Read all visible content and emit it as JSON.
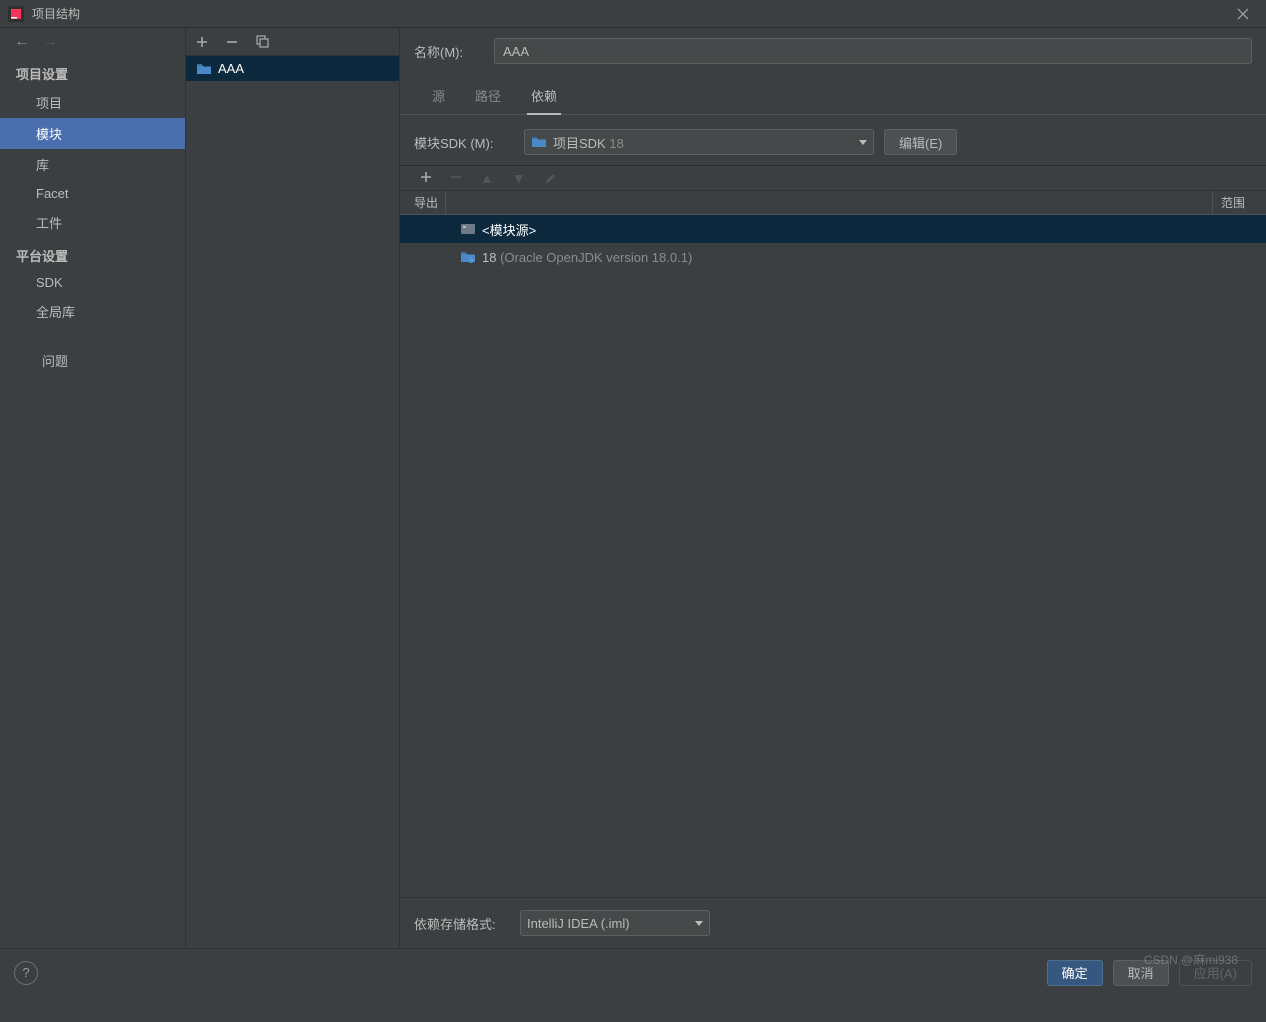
{
  "titlebar": {
    "title": "项目结构"
  },
  "sidebar": {
    "section1_header": "项目设置",
    "items1": [
      "项目",
      "模块",
      "库",
      "Facet",
      "工件"
    ],
    "section2_header": "平台设置",
    "items2": [
      "SDK",
      "全局库"
    ],
    "items3": [
      "问题"
    ]
  },
  "modules": {
    "items": [
      {
        "name": "AAA"
      }
    ]
  },
  "content": {
    "name_label": "名称(M):",
    "name_value": "AAA",
    "tabs": [
      "源",
      "路径",
      "依赖"
    ],
    "sdk_label": "模块SDK (M):",
    "sdk_value": "项目SDK",
    "sdk_hint": " 18",
    "edit_button": "编辑(E)",
    "table": {
      "col_export": "导出",
      "col_scope": "范围",
      "rows": [
        {
          "label": "<模块源>",
          "type": "module"
        },
        {
          "label": "18 ",
          "hint": "(Oracle OpenJDK version 18.0.1)",
          "type": "sdk"
        }
      ]
    },
    "format_label": "依赖存储格式:",
    "format_value": "IntelliJ IDEA (.iml)"
  },
  "buttons": {
    "ok": "确定",
    "cancel": "取消",
    "apply": "应用(A)"
  },
  "watermark": "CSDN @麻mi938"
}
